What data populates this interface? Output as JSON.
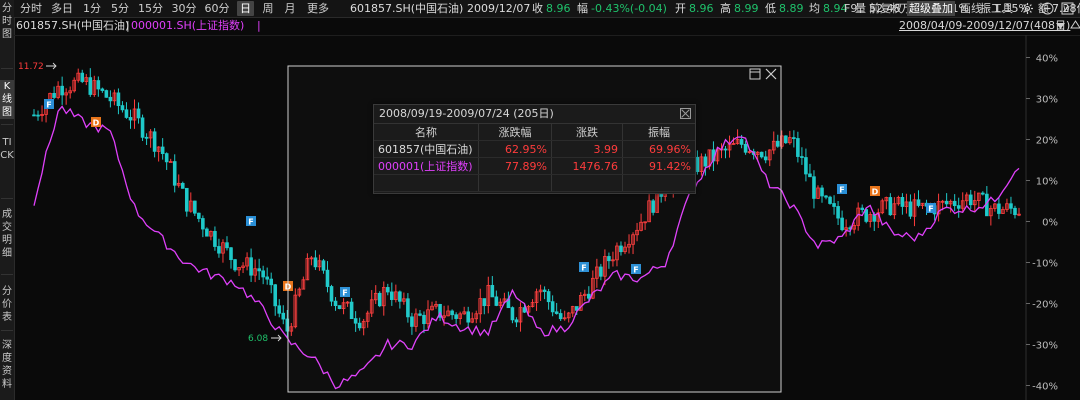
{
  "sidebar": {
    "items": [
      {
        "label": "分时图"
      },
      {
        "label": "K线图"
      },
      {
        "label": "TICK"
      },
      {
        "label": "成交明细"
      },
      {
        "label": "分价表"
      },
      {
        "label": "深度资料"
      }
    ]
  },
  "toolbar": {
    "periods": [
      "分时",
      "多日",
      "1分",
      "5分",
      "15分",
      "30分",
      "60分",
      "日",
      "周",
      "月",
      "更多"
    ],
    "active_period": "日",
    "quote": {
      "code_name": "601857.SH(中国石油)",
      "date": "2009/12/07",
      "close_label": "收",
      "close": "8.96",
      "change_label": "幅",
      "change": "-0.43%(-0.04)",
      "open_label": "开",
      "open": "8.96",
      "high_label": "高",
      "high": "8.99",
      "low_label": "低",
      "low": "8.89",
      "avg_label": "均",
      "avg": "8.94",
      "volume_label": "量",
      "volume": "52.48万",
      "turnover_label": "换",
      "turnover": "1.31%",
      "amplitude_label": "振",
      "amplitude": "1.15%",
      "amount_label": "额",
      "amount": "7.28亿"
    },
    "tools": [
      "F9",
      "前复权",
      "超级叠加",
      "画线",
      "工具"
    ],
    "icons": [
      "gear-icon",
      "minus-icon",
      "wp-icon"
    ]
  },
  "legend": {
    "main": "601857.SH(中国石油)",
    "overlay": "000001.SH(上证指数)",
    "range": "2008/04/09-2009/12/07(408日)"
  },
  "colors": {
    "up": "#ff3c3c",
    "down": "#1fc9c9",
    "overlay_line": "#e040fb",
    "f_marker": "#2a8fd6",
    "d_marker": "#e8741a",
    "selection": "#cfcfcf"
  },
  "chart": {
    "max_label": "11.72",
    "min_label": "6.08",
    "y_ticks": [
      "40%",
      "30%",
      "20%",
      "10%",
      "0%",
      "-10%",
      "-20%",
      "-30%",
      "-40%"
    ],
    "markers": [
      {
        "type": "F"
      },
      {
        "type": "D"
      },
      {
        "type": "F"
      },
      {
        "type": "D"
      },
      {
        "type": "F"
      },
      {
        "type": "F"
      },
      {
        "type": "F"
      },
      {
        "type": "F"
      },
      {
        "type": "D"
      },
      {
        "type": "F"
      }
    ]
  },
  "chart_data": {
    "type": "line",
    "title": "",
    "ylabel": "",
    "ylim": [
      -40,
      40
    ],
    "y_unit": "%",
    "series": [
      {
        "name": "601857.SH(中国石油)",
        "style": "candlestick",
        "values": [
          26,
          33,
          34,
          30,
          25,
          18,
          5,
          -3,
          -10,
          -12,
          -27,
          -8,
          -20,
          -24,
          -16,
          -24,
          -22,
          -23,
          -18,
          -23,
          -16,
          -25,
          -16,
          -7,
          0,
          9,
          13,
          16,
          19,
          17,
          20,
          6,
          0,
          2,
          4,
          3,
          4,
          6,
          3,
          3
        ]
      },
      {
        "name": "000001.SH(上证指数)",
        "style": "line",
        "values": [
          5,
          28,
          24,
          22,
          3,
          -4,
          -10,
          -13,
          -15,
          -21,
          -29,
          -33,
          -40,
          -37,
          -30,
          -30,
          -23,
          -26,
          -27,
          -17,
          -27,
          -26,
          -19,
          -13,
          -14,
          -10,
          7,
          17,
          22,
          10,
          4,
          -6,
          -4,
          4,
          -3,
          -4,
          3,
          3,
          5,
          14
        ]
      }
    ]
  },
  "popup": {
    "title": "2008/09/19-2009/07/24 (205日)",
    "headers": [
      "名称",
      "涨跌幅",
      "涨跌",
      "振幅"
    ],
    "rows": [
      {
        "name": "601857(中国石油)",
        "pct": "62.95%",
        "change": "3.99",
        "amplitude": "69.96%"
      },
      {
        "name": "000001(上证指数)",
        "pct": "77.89%",
        "change": "1476.76",
        "amplitude": "91.42%"
      }
    ]
  }
}
